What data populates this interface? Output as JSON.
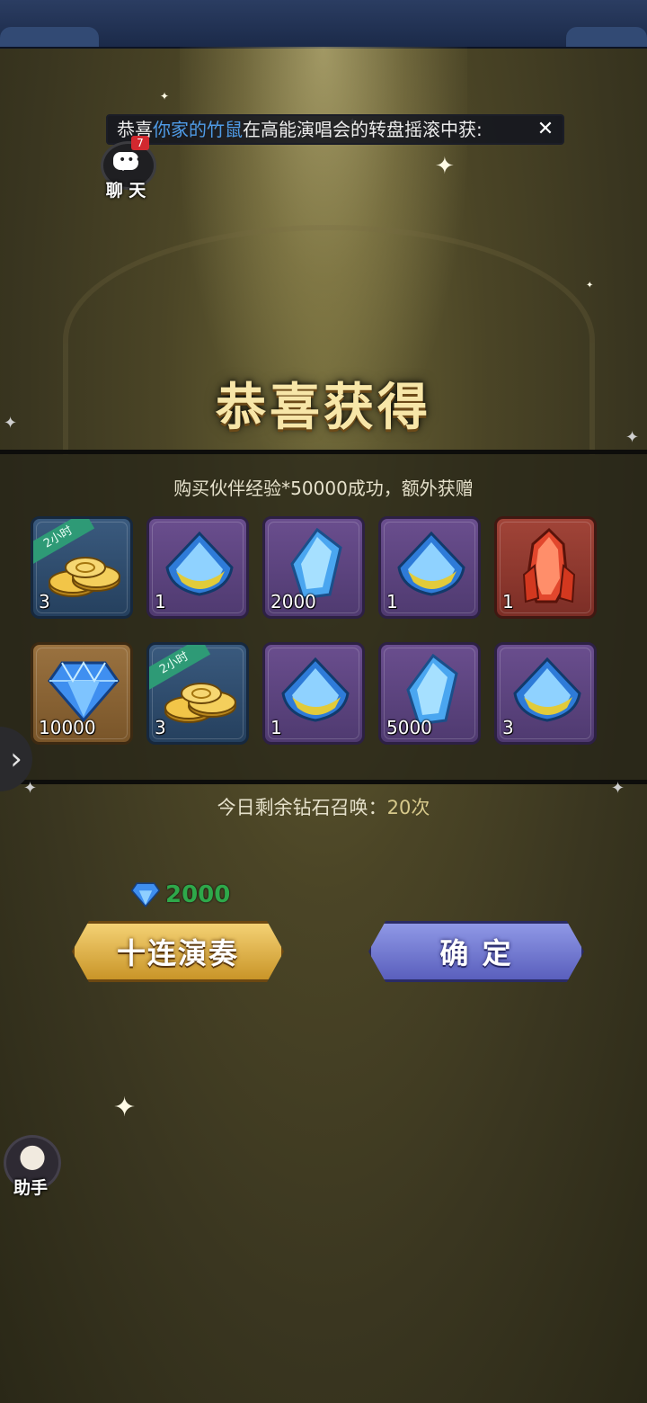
{
  "announcement": {
    "prefix": "恭喜",
    "player": "你家的竹鼠",
    "suffix": "在高能演唱会的转盘摇滚中获:"
  },
  "chat": {
    "label": "聊 天",
    "badge": "7"
  },
  "title": "恭喜获得",
  "panel": {
    "subtitle": "购买伙伴经验*50000成功，额外获赠",
    "items": [
      {
        "type": "coins",
        "count": "3",
        "ribbon": "2小时",
        "frame": "blue"
      },
      {
        "type": "blue-shield",
        "count": "1",
        "frame": "purple"
      },
      {
        "type": "blue-crystal",
        "count": "2000",
        "frame": "purple"
      },
      {
        "type": "blue-shield",
        "count": "1",
        "frame": "purple"
      },
      {
        "type": "red-crystal",
        "count": "1",
        "frame": "red"
      },
      {
        "type": "diamond",
        "count": "10000",
        "frame": "brown"
      },
      {
        "type": "coins",
        "count": "3",
        "ribbon": "2小时",
        "frame": "blue"
      },
      {
        "type": "blue-shield",
        "count": "1",
        "frame": "purple"
      },
      {
        "type": "blue-crystal",
        "count": "5000",
        "frame": "purple"
      },
      {
        "type": "blue-shield",
        "count": "3",
        "frame": "purple"
      }
    ]
  },
  "remaining": {
    "label": "今日剩余钻石召唤：",
    "value": "20次"
  },
  "cost": {
    "icon": "diamond-icon",
    "amount": "2000"
  },
  "buttons": {
    "ten_pull": "十连演奏",
    "confirm": "确 定"
  },
  "helper": {
    "label": "助手"
  },
  "colors": {
    "accent_gold": "#c99528",
    "accent_blue": "#5a5fbd",
    "highlight_name": "#4f9be6",
    "cost_green": "#2ea84a"
  }
}
